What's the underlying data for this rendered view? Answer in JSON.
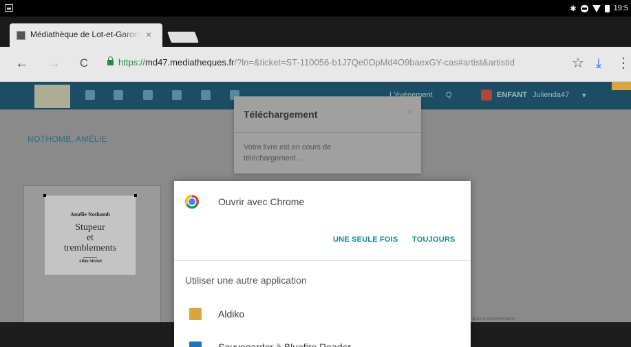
{
  "status_bar": {
    "time": "19:5",
    "icons": [
      "screenshot-icon",
      "bluetooth-icon",
      "do-not-disturb-icon",
      "wifi-icon",
      "battery-icon"
    ]
  },
  "browser": {
    "tab_title": "Médiathèque de Lot-et-Garonne",
    "tab_close": "×",
    "url_scheme": "https://",
    "url_host": "md47.mediatheques.fr",
    "url_path": "/?ln=&ticket=ST-110056-b1J7Qe0OpMd4O9baexGY-cas#artist&artistid",
    "back_label": "←",
    "forward_label": "→",
    "reload_label": "C",
    "bookmark_label": "☆",
    "download_label": "⤓",
    "menu_label": "⋮"
  },
  "site": {
    "nav": {
      "event_label": "L'événement",
      "search_label": "Q",
      "enfant_label": "ENFANT",
      "user_label": "Julienda47",
      "user_caret": "▾"
    },
    "author": "NOTHOMB, AMÉLIE",
    "book_cover": {
      "author": "Amélie Nothomb",
      "title_line1": "Stupeur",
      "title_line2": "et",
      "title_line3": "tremblements",
      "publisher": "Albin Michel"
    },
    "footer_text": "Aucun commentaire"
  },
  "download_popover": {
    "title": "Téléchargement",
    "close": "×",
    "body": "Votre livre est en cours de téléchargement..."
  },
  "chooser": {
    "primary_app": "Ouvrir avec Chrome",
    "just_once": "UNE SEULE FOIS",
    "always": "TOUJOURS",
    "other_heading": "Utiliser une autre application",
    "apps": [
      {
        "label": "Aldiko",
        "icon": "aldiko-icon",
        "color": "#d8a640"
      },
      {
        "label": "Sauvegarder à Bluefire Reader",
        "icon": "bluefire-icon",
        "color": "#1e73be"
      }
    ]
  },
  "colors": {
    "accent": "#0f8a8f",
    "site_nav": "#1d4d63",
    "secure_green": "#1e8e3e"
  }
}
